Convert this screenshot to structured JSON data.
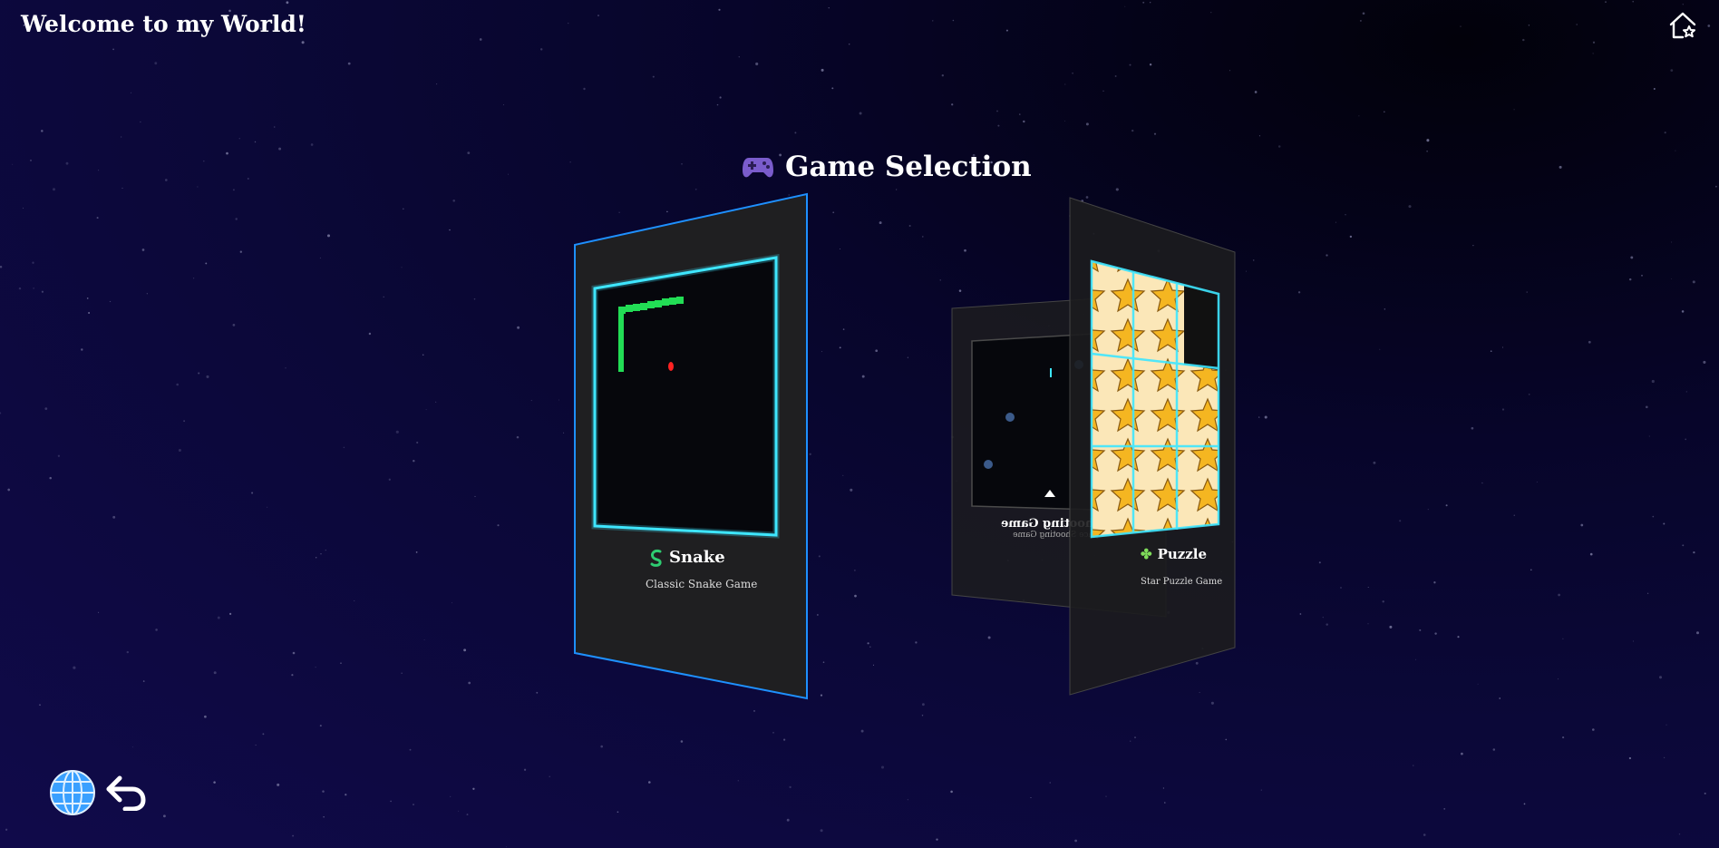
{
  "header": {
    "welcome": "Welcome to my World!",
    "home_icon": "home-star-icon"
  },
  "selection": {
    "title": "Game Selection",
    "title_icon": "gamepad-icon"
  },
  "games": [
    {
      "name": "Snake",
      "subtitle": "Classic Snake Game",
      "icon": "snake-icon",
      "selected": true
    },
    {
      "name": "Shooting Game",
      "subtitle": "Space Shooting Game",
      "icon": "rocket-icon",
      "selected": false
    },
    {
      "name": "Puzzle",
      "subtitle": "Star Puzzle Game",
      "icon": "puzzle-piece-icon",
      "selected": false
    }
  ],
  "footer": {
    "language_icon": "globe-icon",
    "back_icon": "back-arrow-icon"
  },
  "colors": {
    "accent": "#1e90ff",
    "glow": "#3ee6ff",
    "snake": "#22dd55",
    "food": "#ff2222"
  }
}
